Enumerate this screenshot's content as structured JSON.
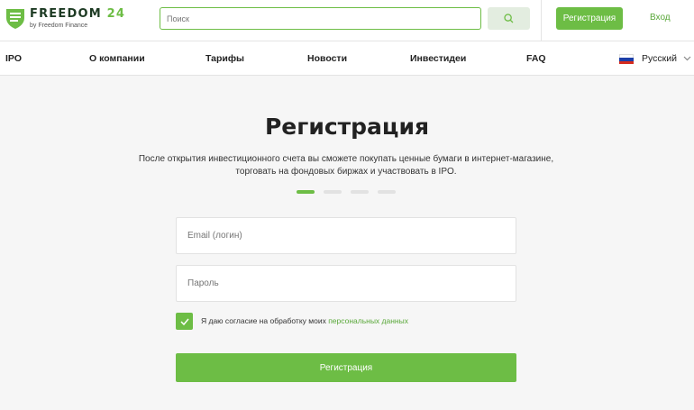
{
  "header": {
    "logo": {
      "title_main": "FREEDOM",
      "title_num": "24",
      "subtitle": "by Freedom Finance",
      "icon": "shield-logo-icon"
    },
    "search": {
      "placeholder": "Поиск",
      "icon": "search-icon"
    },
    "register_label": "Регистрация",
    "login_label": "Вход"
  },
  "nav": {
    "items": [
      {
        "label": "IPO"
      },
      {
        "label": "О компании"
      },
      {
        "label": "Тарифы"
      },
      {
        "label": "Новости"
      },
      {
        "label": "Инвестидеи"
      },
      {
        "label": "FAQ"
      }
    ],
    "language": {
      "label": "Русский",
      "flag": "russia-flag-icon",
      "flag_colors": [
        "#ffffff",
        "#1c3fa8",
        "#d52b1e"
      ]
    }
  },
  "main": {
    "title": "Регистрация",
    "subtitle": "После открытия инвестиционного счета вы сможете покупать ценные бумаги в интернет-магазине, торговать на фондовых биржах и участвовать в IPO.",
    "steps": {
      "total": 4,
      "current": 1
    },
    "email_placeholder": "Email (логин)",
    "password_placeholder": "Пароль",
    "consent": {
      "text": "Я даю согласие на обработку моих ",
      "link": "персональных данных",
      "checked": true
    },
    "submit_label": "Регистрация"
  },
  "colors": {
    "accent": "#6dbd45",
    "link": "#5aa83a",
    "background": "#f6f6f6"
  }
}
